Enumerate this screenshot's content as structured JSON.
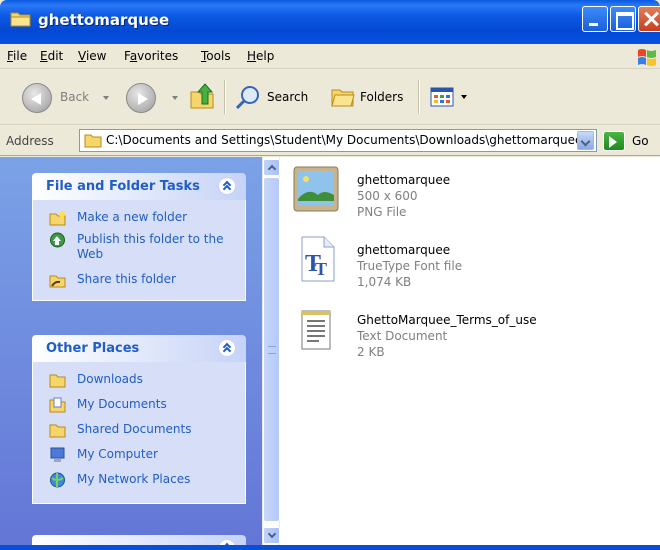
{
  "window": {
    "title": "ghettomarquee"
  },
  "menubar": {
    "file": {
      "key": "F",
      "rest": "ile"
    },
    "edit": {
      "key": "E",
      "rest": "dit"
    },
    "view": {
      "key": "V",
      "rest": "iew"
    },
    "favorites": {
      "pre": "F",
      "key": "a",
      "rest": "vorites"
    },
    "tools": {
      "key": "T",
      "rest": "ools"
    },
    "help": {
      "key": "H",
      "rest": "elp"
    }
  },
  "toolbar": {
    "back_label": "Back",
    "search_label": "Search",
    "folders_label": "Folders"
  },
  "address": {
    "label": "Address",
    "path": "C:\\Documents and Settings\\Student\\My Documents\\Downloads\\ghettomarquee",
    "go_label": "Go"
  },
  "tasks": {
    "title": "File and Folder Tasks",
    "items": [
      {
        "label": "Make a new folder",
        "icon": "new-folder-icon"
      },
      {
        "label": "Publish this folder to the Web",
        "icon": "publish-web-icon"
      },
      {
        "label": "Share this folder",
        "icon": "share-folder-icon"
      }
    ]
  },
  "places": {
    "title": "Other Places",
    "items": [
      {
        "label": "Downloads",
        "icon": "folder-icon"
      },
      {
        "label": "My Documents",
        "icon": "my-documents-icon"
      },
      {
        "label": "Shared Documents",
        "icon": "folder-icon"
      },
      {
        "label": "My Computer",
        "icon": "computer-icon"
      },
      {
        "label": "My Network Places",
        "icon": "network-icon"
      }
    ]
  },
  "files": [
    {
      "name": "ghettomarquee",
      "line1": "500 x 600",
      "line2": "PNG File",
      "icon": "image-file-icon"
    },
    {
      "name": "ghettomarquee",
      "line1": "TrueType Font file",
      "line2": "1,074 KB",
      "icon": "font-file-icon"
    },
    {
      "name": "GhettoMarquee_Terms_of_use",
      "line1": "Text Document",
      "line2": "2 KB",
      "icon": "text-document-icon"
    }
  ],
  "colors": {
    "titlebar": "#0553e0",
    "taskpane": "#6f8ede",
    "link": "#215dc6"
  }
}
